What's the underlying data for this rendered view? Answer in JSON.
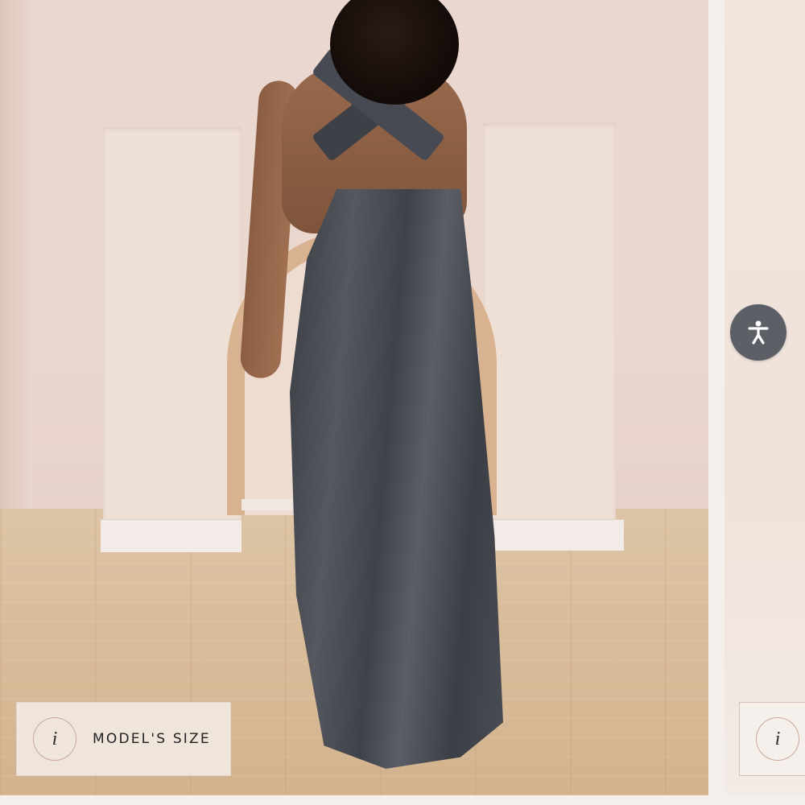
{
  "gallery": {
    "main_slide": {
      "badge": {
        "icon": "info-icon",
        "icon_glyph": "i",
        "label": "MODEL'S SIZE"
      }
    },
    "next_slide": {
      "badge": {
        "icon": "info-icon",
        "icon_glyph": "i"
      }
    }
  },
  "accessibility": {
    "icon": "accessibility-person-icon"
  },
  "colors": {
    "wall": "#ead8cf",
    "floor": "#d9bd9b",
    "dress": "#474a52",
    "a11y_button": "#5c6066",
    "badge_bg": "#f4ede8"
  }
}
